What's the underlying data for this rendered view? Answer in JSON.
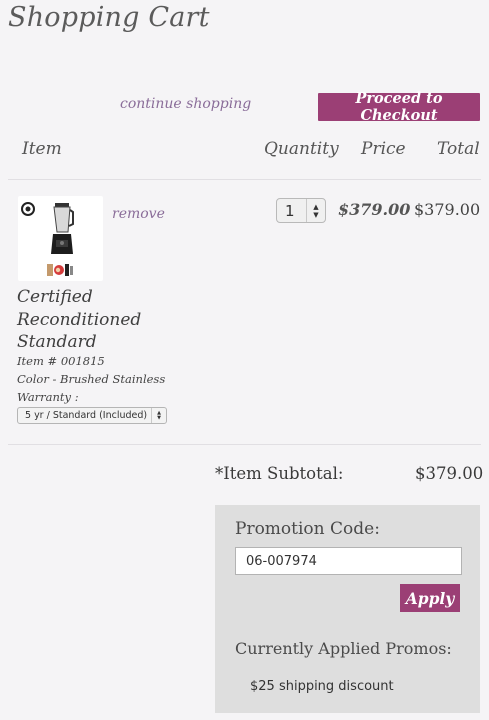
{
  "page": {
    "title": "Shopping Cart",
    "continue_link": "continue shopping",
    "checkout_button": "Proceed to Checkout"
  },
  "columns": {
    "item": "Item",
    "quantity": "Quantity",
    "price": "Price",
    "total": "Total"
  },
  "cart_item": {
    "remove_link": "remove",
    "quantity": "1",
    "price": "$379.00",
    "total": "$379.00",
    "name": "Certified Reconditioned Standard",
    "item_number": "Item # 001815",
    "color": "Color - Brushed Stainless",
    "warranty_label": "Warranty :",
    "warranty_selected": "5 yr / Standard (Included)",
    "image_icon": "blender-icon"
  },
  "summary": {
    "subtotal_label": "*Item Subtotal:",
    "subtotal_value": "$379.00"
  },
  "promo": {
    "label": "Promotion Code:",
    "code_value": "06-007974",
    "apply_button": "Apply",
    "applied_label": "Currently Applied Promos:",
    "applied_items": [
      "$25 shipping discount"
    ]
  },
  "colors": {
    "accent": "#9b3f75",
    "link": "#8a6d99",
    "promo_bg": "#dedede",
    "page_bg": "#f5f4f6"
  }
}
